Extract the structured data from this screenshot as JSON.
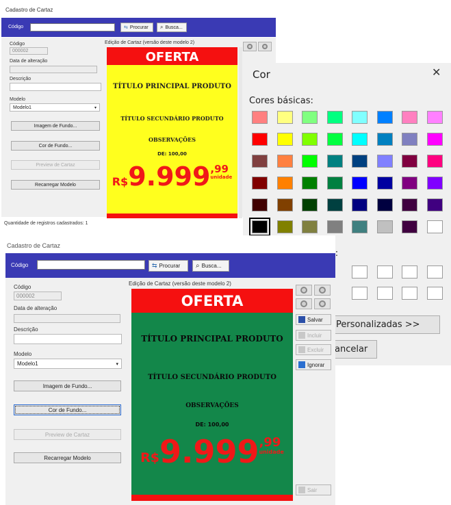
{
  "top_window": {
    "title": "Cadastro de Cartaz",
    "toolbar": {
      "codigo_label": "Código",
      "codigo_value": "",
      "procurar_label": "Procurar",
      "busca_label": "Busca..."
    },
    "form": {
      "codigo_label": "Código",
      "codigo_value": "000002",
      "data_label": "Data de alteração",
      "data_value": "",
      "descricao_label": "Descrição",
      "descricao_value": "",
      "modelo_label": "Modelo",
      "modelo_value": "Modelo1",
      "imagem_button": "Imagem de Fundo...",
      "cor_button": "Cor de Fundo...",
      "preview_button": "Preview de Cartaz",
      "recarregar_button": "Recarregar Modelo"
    },
    "editor_label": "Edição de Cartaz (versão deste modelo 2)",
    "status": "Quantidade de registros cadastrados: 1",
    "poster": {
      "background_color": "#ffff1e",
      "header": "OFERTA",
      "title_main": "TÍTULO PRINCIPAL PRODUTO",
      "title_secondary": "TÍTULO SECUNDÁRIO PRODUTO",
      "observacoes": "OBSERVAÇÕES",
      "de_price": "DE: 100,00",
      "currency": "R$",
      "price_int": "9.999",
      "price_cents": ",99",
      "unit": "unidade"
    }
  },
  "bottom_window": {
    "title": "Cadastro de Cartaz",
    "toolbar": {
      "codigo_label": "Código",
      "codigo_value": "",
      "procurar_label": "Procurar",
      "busca_label": "Busca..."
    },
    "form": {
      "codigo_label": "Código",
      "codigo_value": "000002",
      "data_label": "Data de alteração",
      "data_value": "",
      "descricao_label": "Descrição",
      "descricao_value": "",
      "modelo_label": "Modelo",
      "modelo_value": "Modelo1",
      "imagem_button": "Imagem de Fundo...",
      "cor_button": "Cor de Fundo...",
      "preview_button": "Preview de Cartaz",
      "recarregar_button": "Recarregar Modelo"
    },
    "editor_label": "Edição de Cartaz (versão deste modelo 2)",
    "actions": {
      "salvar": "Salvar",
      "incluir": "Incluir",
      "excluir": "Excluir",
      "ignorar": "Ignorar",
      "sair": "Sair"
    },
    "poster": {
      "background_color": "#13874a",
      "header": "OFERTA",
      "title_main": "TÍTULO PRINCIPAL PRODUTO",
      "title_secondary": "TÍTULO SECUNDÁRIO PRODUTO",
      "observacoes": "OBSERVAÇÕES",
      "de_price": "DE: 100,00",
      "currency": "R$",
      "price_int": "9.999",
      "price_cents": ",99",
      "unit": "unidade"
    }
  },
  "color_dialog": {
    "title": "Cor",
    "close_icon": "close-icon",
    "basic_colors_label": "Cores básicas:",
    "custom_colors_label_partial": "s:",
    "define_custom_partial": "Personalizadas >>",
    "cancel_partial": "ancelar",
    "selected_color": "#000000",
    "basic_colors": [
      [
        "#ff8080",
        "#ffff80",
        "#80ff80",
        "#00ff80",
        "#80ffff",
        "#0080ff",
        "#ff80c0",
        "#ff80ff"
      ],
      [
        "#ff0000",
        "#ffff00",
        "#80ff00",
        "#00ff40",
        "#00ffff",
        "#0080c0",
        "#8080c0",
        "#ff00ff"
      ],
      [
        "#804040",
        "#ff8040",
        "#00ff00",
        "#008080",
        "#004080",
        "#8080ff",
        "#800040",
        "#ff0080"
      ],
      [
        "#800000",
        "#ff8000",
        "#008000",
        "#008040",
        "#0000ff",
        "#0000a0",
        "#800080",
        "#8000ff"
      ],
      [
        "#400000",
        "#804000",
        "#004000",
        "#004040",
        "#000080",
        "#000040",
        "#400040",
        "#400080"
      ],
      [
        "#000000",
        "#808000",
        "#808040",
        "#808080",
        "#408080",
        "#c0c0c0",
        "#400040",
        "#ffffff"
      ]
    ]
  }
}
